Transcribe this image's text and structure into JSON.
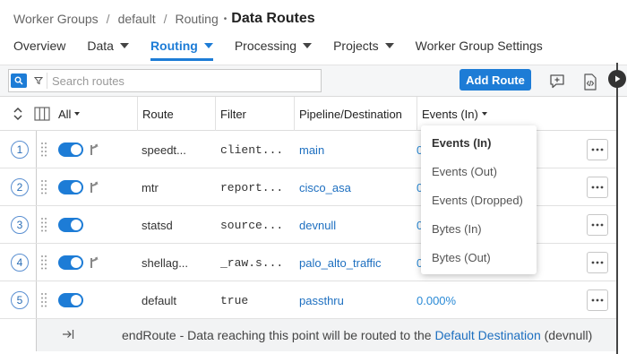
{
  "breadcrumb": {
    "items": [
      "Worker Groups",
      "default",
      "Routing"
    ],
    "separator": "/",
    "current_marker": "•",
    "current": "Data Routes"
  },
  "nav": {
    "tabs": [
      {
        "label": "Overview",
        "has_caret": false,
        "active": false
      },
      {
        "label": "Data",
        "has_caret": true,
        "active": false
      },
      {
        "label": "Routing",
        "has_caret": true,
        "active": true
      },
      {
        "label": "Processing",
        "has_caret": true,
        "active": false
      },
      {
        "label": "Projects",
        "has_caret": true,
        "active": false
      },
      {
        "label": "Worker Group Settings",
        "has_caret": false,
        "active": false
      }
    ]
  },
  "toolbar": {
    "search_placeholder": "Search routes",
    "add_route_label": "Add Route",
    "icons": [
      "search-icon",
      "filter-icon",
      "add-comment-icon",
      "code-file-icon",
      "play-icon"
    ]
  },
  "table": {
    "headers": {
      "select": "All",
      "route": "Route",
      "filter": "Filter",
      "pipeline": "Pipeline/Destination",
      "events": "Events (In)"
    },
    "rows": [
      {
        "num": "1",
        "route": "speedt...",
        "filter": "client...",
        "pipeline": "main",
        "events": "0",
        "enabled": true,
        "has_branch": true
      },
      {
        "num": "2",
        "route": "mtr",
        "filter": "report...",
        "pipeline": "cisco_asa",
        "events": "0",
        "enabled": true,
        "has_branch": true
      },
      {
        "num": "3",
        "route": "statsd",
        "filter": "source...",
        "pipeline": "devnull",
        "events": "0",
        "enabled": true,
        "has_branch": false
      },
      {
        "num": "4",
        "route": "shellag...",
        "filter": "_raw.s...",
        "pipeline": "palo_alto_traffic",
        "events": "0",
        "enabled": true,
        "has_branch": true
      },
      {
        "num": "5",
        "route": "default",
        "filter": "true",
        "pipeline": "passthru",
        "events": "0.000%",
        "enabled": true,
        "has_branch": false
      }
    ],
    "endroute": {
      "text": "endRoute - Data reaching this point will be routed to the",
      "link": "Default Destination",
      "suffix": "(devnull)"
    }
  },
  "events_menu": {
    "items": [
      "Events (In)",
      "Events (Out)",
      "Events (Dropped)",
      "Bytes (In)",
      "Bytes (Out)"
    ],
    "selected": "Events (In)"
  },
  "colors": {
    "accent": "#1d7cd6",
    "link": "#1d6fc0"
  }
}
